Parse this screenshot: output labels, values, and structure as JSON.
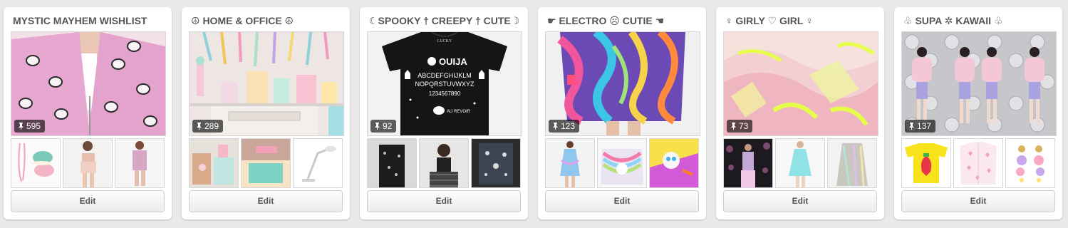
{
  "boards": [
    {
      "title": "MYSTIC MAYHEM WISHLIST",
      "cover": {
        "image": "pink-heart-print-moto-jacket",
        "pin_count": "595"
      },
      "thumbs": [
        "pastel-earbuds-macarons",
        "floral-crop-set",
        "pastel-romper"
      ],
      "edit_label": "Edit"
    },
    {
      "title": "☮ HOME & OFFICE ☮",
      "cover": {
        "image": "pastel-dessert-table",
        "pin_count": "289"
      },
      "thumbs": [
        "floral-desk-organizers",
        "get-organized-desk",
        "white-desk-lamp"
      ],
      "edit_label": "Edit"
    },
    {
      "title": "☾SPOOKY † CREEPY † CUTE☽",
      "cover": {
        "image": "ouija-black-tee",
        "pin_count": "92",
        "shirt_text": {
          "brand": "LUCKY",
          "heading": "OUIJA",
          "row1": "ABCDEFGHIJKLM",
          "row2": "NOPQRSTUVWXYZ",
          "row3": "1234567890",
          "bye": "AU REVOIR"
        }
      },
      "thumbs": [
        "black-studded-vest",
        "checkered-tights-girl",
        "denim-battle-vest"
      ],
      "edit_label": "Edit"
    },
    {
      "title": "☛ ELECTRO ☹ CUTIE ☚",
      "cover": {
        "image": "psychedelic-swirl-dress",
        "pin_count": "123"
      },
      "thumbs": [
        "tie-dye-skater-dress",
        "rainbow-kitten-sweater",
        "neon-cat-print"
      ],
      "edit_label": "Edit"
    },
    {
      "title": "♀ GIRLY ♡ GIRL ♀",
      "cover": {
        "image": "pink-yellow-sheer-fabric",
        "pin_count": "73"
      },
      "thumbs": [
        "floral-runway-outfit",
        "mint-lace-dress",
        "holographic-coat"
      ],
      "edit_label": "Edit"
    },
    {
      "title": "♧ SUPA ✲ KAWAII ♧",
      "cover": {
        "image": "pink-fur-coat-bubble-wrap",
        "pin_count": "137"
      },
      "thumbs": [
        "strawberry-yellow-tee",
        "heart-knit-cardigan",
        "pastel-drop-earrings"
      ],
      "edit_label": "Edit"
    }
  ],
  "colors": {
    "page_bg": "#e9e9e9",
    "card_bg": "#ffffff",
    "title_text": "#555555",
    "badge_bg": "rgba(0,0,0,0.62)"
  }
}
